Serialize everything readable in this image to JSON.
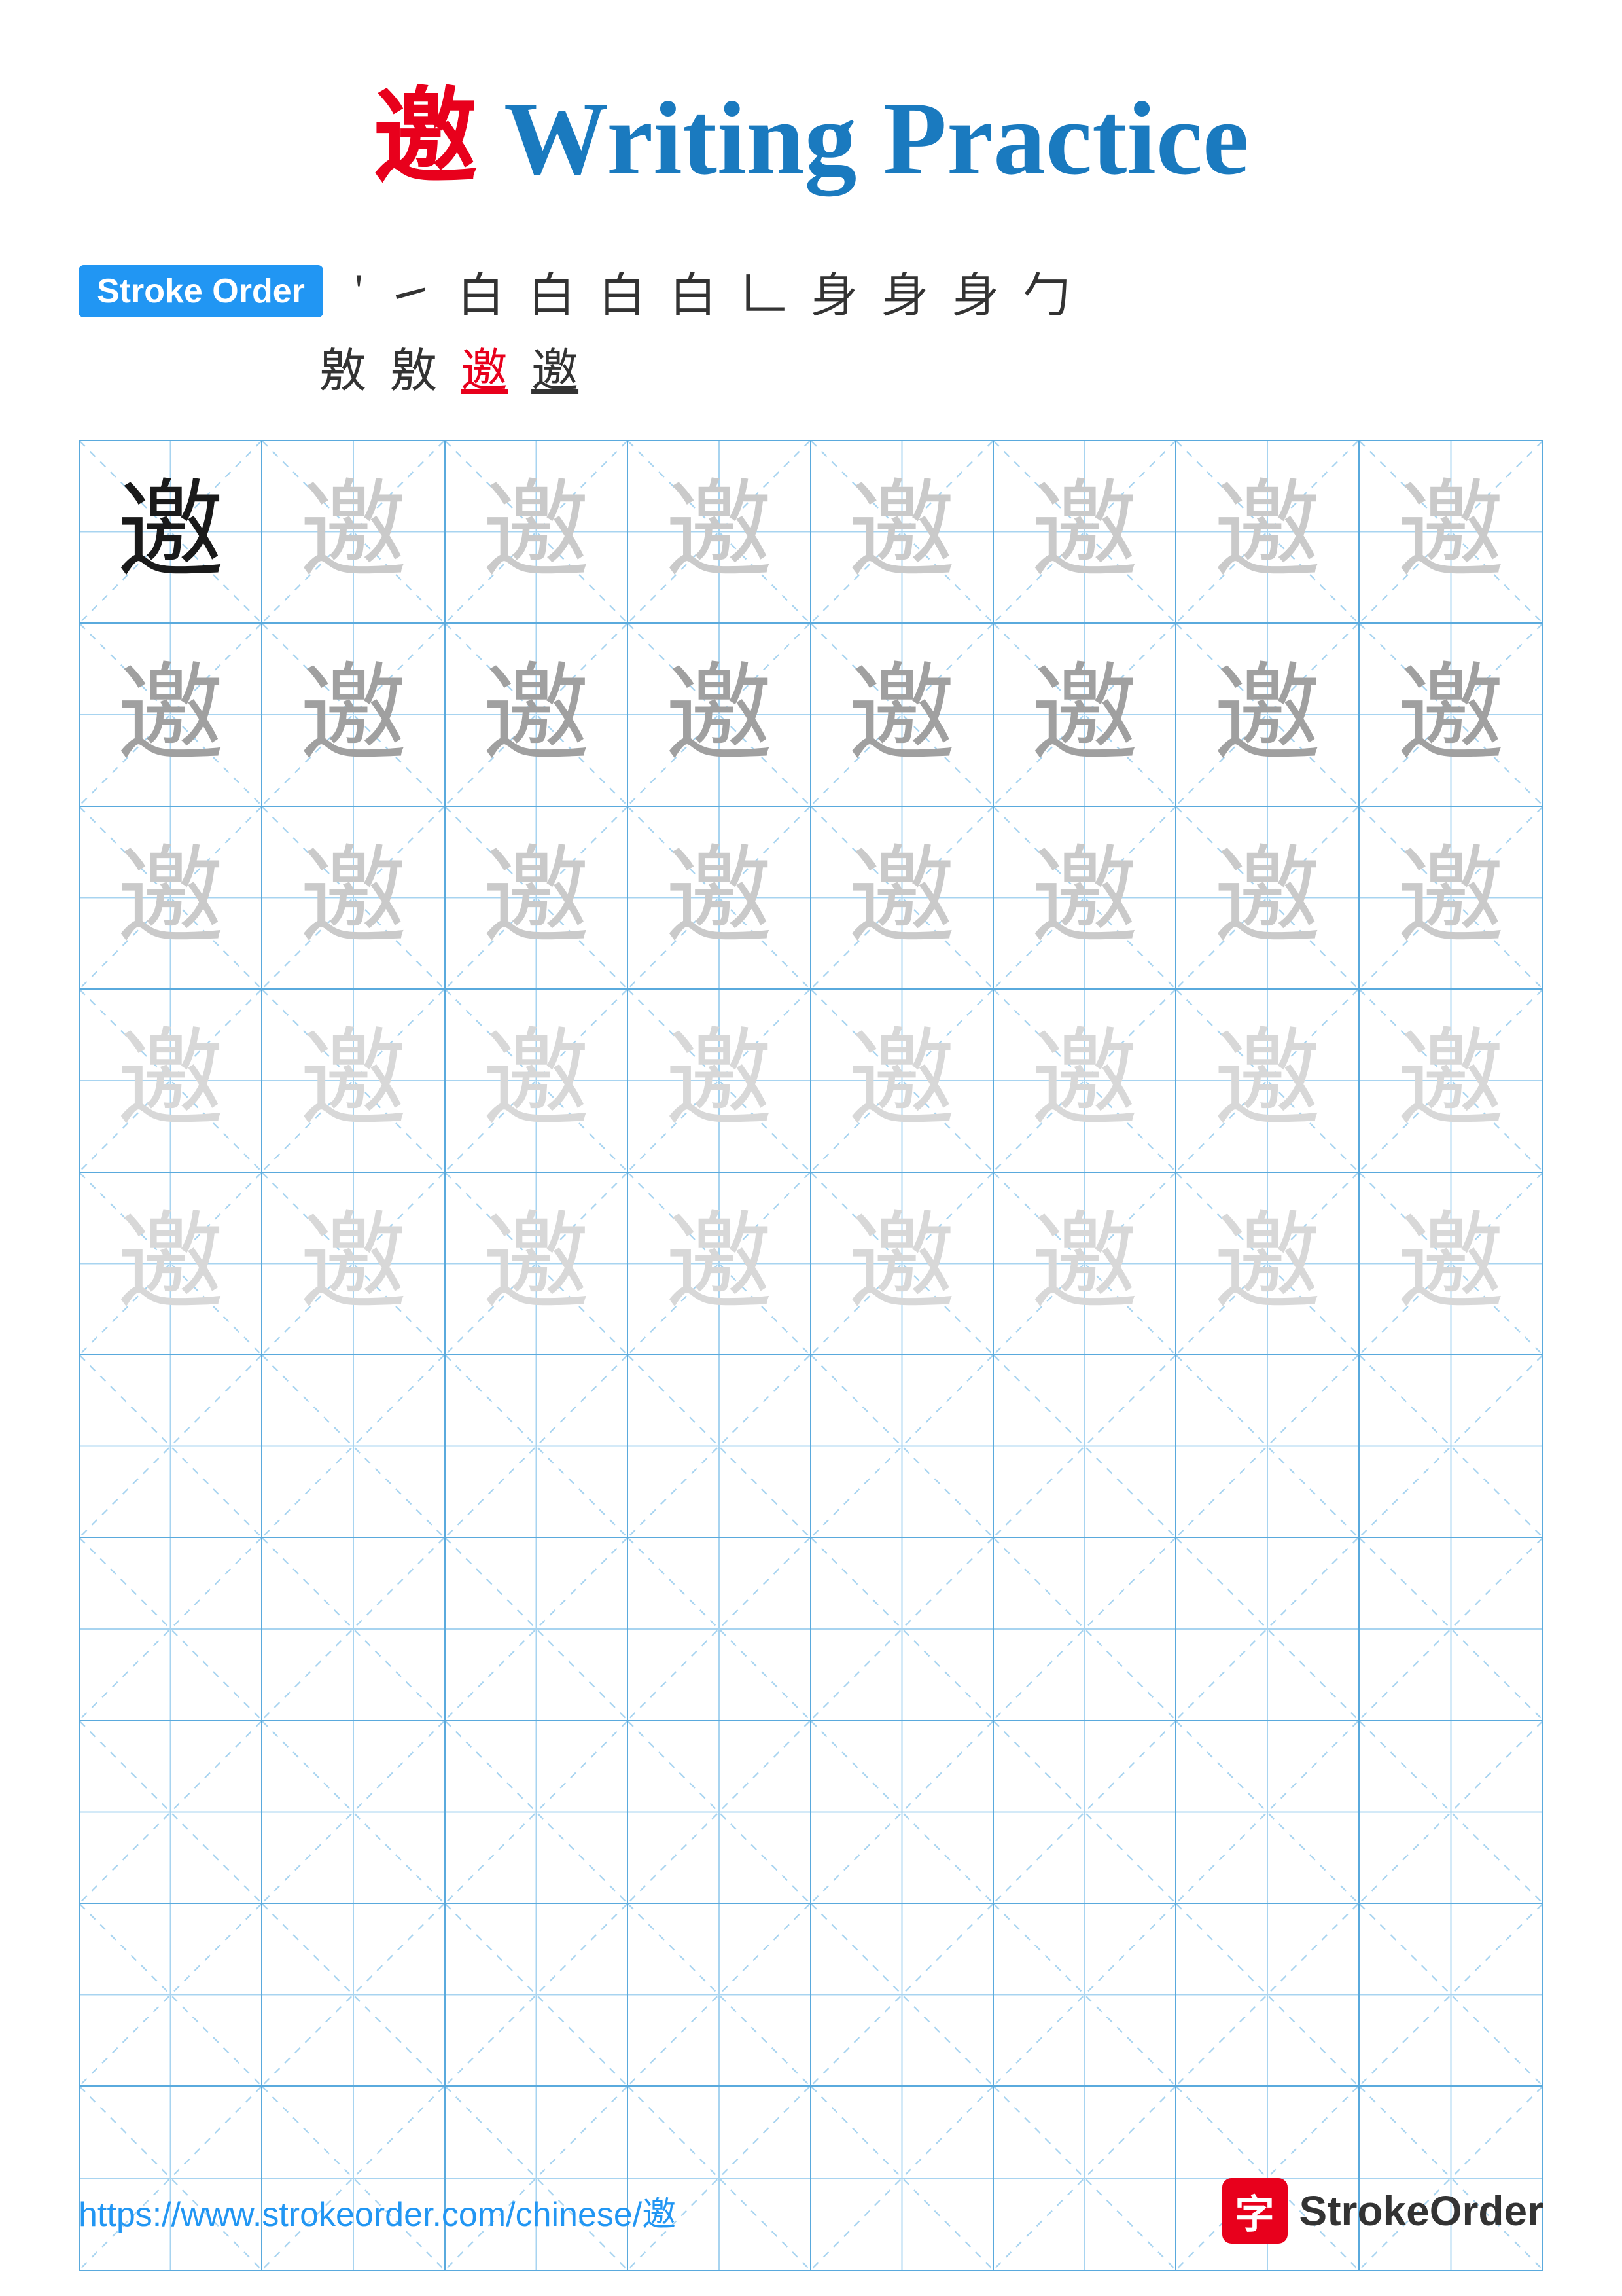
{
  "title": {
    "char": "邀",
    "suffix": " Writing Practice"
  },
  "stroke_order": {
    "badge_label": "Stroke Order",
    "strokes": [
      "'",
      "㇀",
      "白",
      "白",
      "白",
      "白",
      "𠃊",
      "身",
      "身",
      "身",
      "勹",
      "敫",
      "敫",
      "邀",
      "邀"
    ]
  },
  "grid": {
    "rows": 10,
    "cols": 8,
    "char": "邀",
    "practice_rows": [
      [
        "dark",
        "light",
        "light",
        "light",
        "light",
        "light",
        "light",
        "light"
      ],
      [
        "medium",
        "medium",
        "medium",
        "medium",
        "medium",
        "medium",
        "medium",
        "medium"
      ],
      [
        "light",
        "light",
        "light",
        "light",
        "light",
        "light",
        "light",
        "light"
      ],
      [
        "very-light",
        "very-light",
        "very-light",
        "very-light",
        "very-light",
        "very-light",
        "very-light",
        "very-light"
      ],
      [
        "very-light",
        "very-light",
        "very-light",
        "very-light",
        "very-light",
        "very-light",
        "very-light",
        "very-light"
      ],
      [
        "empty",
        "empty",
        "empty",
        "empty",
        "empty",
        "empty",
        "empty",
        "empty"
      ],
      [
        "empty",
        "empty",
        "empty",
        "empty",
        "empty",
        "empty",
        "empty",
        "empty"
      ],
      [
        "empty",
        "empty",
        "empty",
        "empty",
        "empty",
        "empty",
        "empty",
        "empty"
      ],
      [
        "empty",
        "empty",
        "empty",
        "empty",
        "empty",
        "empty",
        "empty",
        "empty"
      ],
      [
        "empty",
        "empty",
        "empty",
        "empty",
        "empty",
        "empty",
        "empty",
        "empty"
      ]
    ]
  },
  "footer": {
    "url": "https://www.strokeorder.com/chinese/邀",
    "logo_char": "字",
    "logo_text": "StrokeOrder"
  }
}
